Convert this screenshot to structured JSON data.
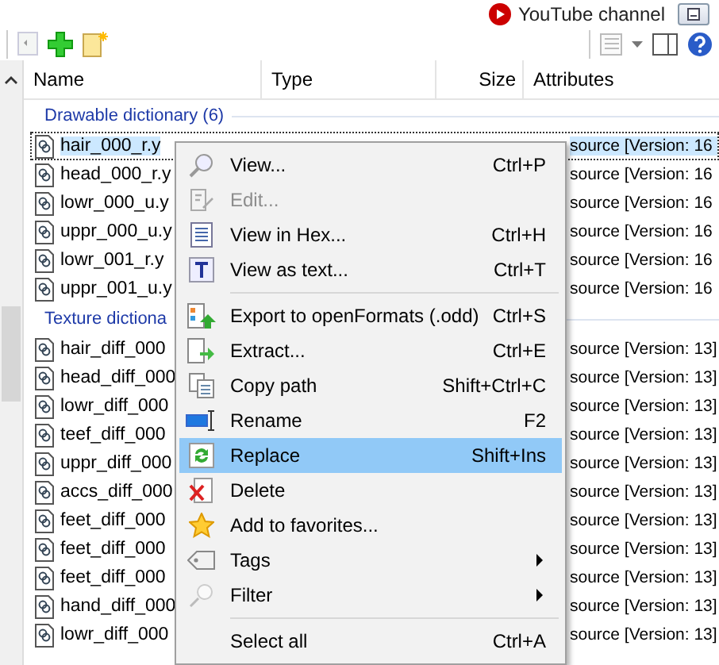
{
  "top_bar": {
    "link": "YouTube channel"
  },
  "columns": [
    "Name",
    "Type",
    "Size",
    "Attributes"
  ],
  "groups": [
    {
      "title": "Drawable dictionary (6)",
      "rows": [
        {
          "name": "hair_000_r.y",
          "attributes": "source [Version: 16",
          "selected": true
        },
        {
          "name": "head_000_r.y",
          "attributes": "source [Version: 16",
          "selected": false
        },
        {
          "name": "lowr_000_u.y",
          "attributes": "source [Version: 16",
          "selected": false
        },
        {
          "name": "uppr_000_u.y",
          "attributes": "source [Version: 16",
          "selected": false
        },
        {
          "name": "lowr_001_r.y",
          "attributes": "source [Version: 16",
          "selected": false
        },
        {
          "name": "uppr_001_u.y",
          "attributes": "source [Version: 16",
          "selected": false
        }
      ]
    },
    {
      "title": "Texture dictiona",
      "rows": [
        {
          "name": "hair_diff_000",
          "attributes": "source [Version: 13]",
          "selected": false
        },
        {
          "name": "head_diff_000",
          "attributes": "source [Version: 13]",
          "selected": false
        },
        {
          "name": "lowr_diff_000",
          "attributes": "source [Version: 13]",
          "selected": false
        },
        {
          "name": "teef_diff_000",
          "attributes": "source [Version: 13]",
          "selected": false
        },
        {
          "name": "uppr_diff_000",
          "attributes": "source [Version: 13]",
          "selected": false
        },
        {
          "name": "accs_diff_000",
          "attributes": "source [Version: 13]",
          "selected": false
        },
        {
          "name": "feet_diff_000",
          "attributes": "source [Version: 13]",
          "selected": false
        },
        {
          "name": "feet_diff_000",
          "attributes": "source [Version: 13]",
          "selected": false
        },
        {
          "name": "feet_diff_000",
          "attributes": "source [Version: 13]",
          "selected": false
        },
        {
          "name": "hand_diff_000",
          "attributes": "source [Version: 13]",
          "selected": false
        },
        {
          "name": "lowr_diff_000",
          "attributes": "source [Version: 13]",
          "selected": false
        }
      ]
    }
  ],
  "context_menu": [
    {
      "kind": "item",
      "label": "View...",
      "shortcut": "Ctrl+P",
      "disabled": false,
      "selected": false,
      "submenu": false
    },
    {
      "kind": "item",
      "label": "Edit...",
      "disabled": true,
      "selected": false,
      "submenu": false
    },
    {
      "kind": "item",
      "label": "View in Hex...",
      "shortcut": "Ctrl+H",
      "disabled": false,
      "selected": false,
      "submenu": false
    },
    {
      "kind": "item",
      "label": "View as text...",
      "shortcut": "Ctrl+T",
      "disabled": false,
      "selected": false,
      "submenu": false
    },
    {
      "kind": "separator"
    },
    {
      "kind": "item",
      "label": "Export to openFormats (.odd)",
      "shortcut": "Ctrl+S",
      "disabled": false,
      "selected": false,
      "submenu": false
    },
    {
      "kind": "item",
      "label": "Extract...",
      "shortcut": "Ctrl+E",
      "disabled": false,
      "selected": false,
      "submenu": false
    },
    {
      "kind": "item",
      "label": "Copy path",
      "shortcut": "Shift+Ctrl+C",
      "disabled": false,
      "selected": false,
      "submenu": false
    },
    {
      "kind": "item",
      "label": "Rename",
      "shortcut": "F2",
      "disabled": false,
      "selected": false,
      "submenu": false
    },
    {
      "kind": "item",
      "label": "Replace",
      "shortcut": "Shift+Ins",
      "disabled": false,
      "selected": true,
      "submenu": false
    },
    {
      "kind": "item",
      "label": "Delete",
      "disabled": false,
      "selected": false,
      "submenu": false
    },
    {
      "kind": "item",
      "label": "Add to favorites...",
      "disabled": false,
      "selected": false,
      "submenu": false
    },
    {
      "kind": "item",
      "label": "Tags",
      "disabled": false,
      "selected": false,
      "submenu": true
    },
    {
      "kind": "item",
      "label": "Filter",
      "disabled": false,
      "selected": false,
      "submenu": true
    },
    {
      "kind": "separator"
    },
    {
      "kind": "item",
      "label": "Select all",
      "shortcut": "Ctrl+A",
      "disabled": false,
      "selected": false,
      "submenu": false
    }
  ]
}
